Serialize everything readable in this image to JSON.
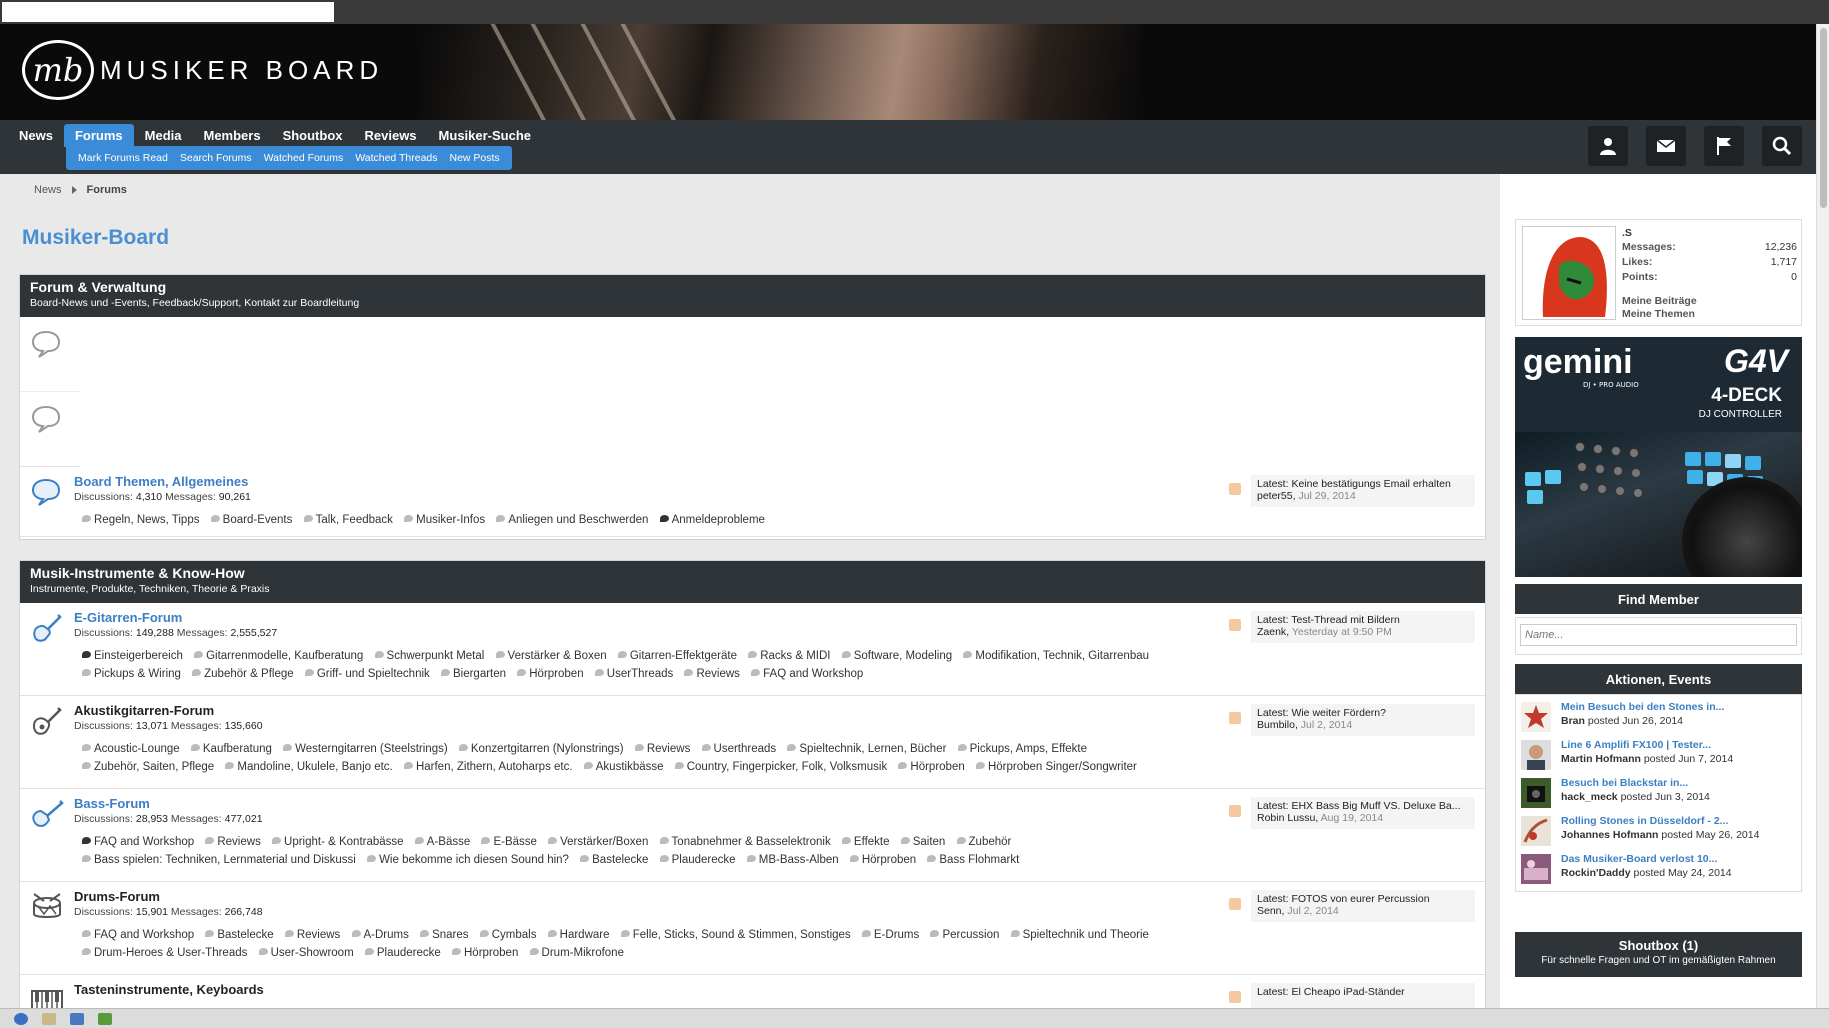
{
  "site": {
    "logo_mark": "mb",
    "logo_text": "MUSIKER BOARD"
  },
  "nav": {
    "tabs": [
      "News",
      "Forums",
      "Media",
      "Members",
      "Shoutbox",
      "Reviews",
      "Musiker-Suche"
    ],
    "active_tab": "Forums",
    "subnav": [
      "Mark Forums Read",
      "Search Forums",
      "Watched Forums",
      "Watched Threads",
      "New Posts"
    ],
    "icons": [
      "user-icon",
      "mail-icon",
      "flag-icon",
      "search-icon"
    ]
  },
  "breadcrumb": {
    "items": [
      "News",
      "Forums"
    ]
  },
  "page_title": "Musiker-Board",
  "categories": [
    {
      "title": "Forum & Verwaltung",
      "desc": "Board-News und -Events, Feedback/Support, Kontakt zur Boardleitung",
      "nodes": [
        {
          "title": "Board Themen, Allgemeines",
          "discussions": "4,310",
          "messages": "90,261",
          "subforums": [
            "Regeln, News, Tipps",
            "Board-Events",
            "Talk, Feedback",
            "Musiker-Infos",
            "Anliegen und Beschwerden",
            "Anmeldeprobleme"
          ],
          "latest": {
            "title": "Latest: Keine bestätigungs Email erhalten",
            "user": "peter55",
            "date": "Jul 29, 2014"
          }
        }
      ]
    },
    {
      "title": "Musik-Instrumente & Know-How",
      "desc": "Instrumente, Produkte, Techniken, Theorie & Praxis",
      "nodes": [
        {
          "title": "E-Gitarren-Forum",
          "discussions": "149,288",
          "messages": "2,555,527",
          "subforums": [
            "Einsteigerbereich",
            "Gitarrenmodelle, Kaufberatung",
            "Schwerpunkt Metal",
            "Verstärker & Boxen",
            "Gitarren-Effektgeräte",
            "Racks & MIDI",
            "Software, Modeling",
            "Modifikation, Technik, Gitarrenbau",
            "Pickups & Wiring",
            "Zubehör & Pflege",
            "Griff- und Spieltechnik",
            "Biergarten",
            "Hörproben",
            "UserThreads",
            "Reviews",
            "FAQ and Workshop"
          ],
          "latest": {
            "title": "Latest: Test-Thread mit Bildern",
            "user": "Zaenk",
            "date": "Yesterday at 9:50 PM"
          }
        },
        {
          "title": "Akustikgitarren-Forum",
          "discussions": "13,071",
          "messages": "135,660",
          "subforums": [
            "Acoustic-Lounge",
            "Kaufberatung",
            "Westerngitarren (Steelstrings)",
            "Konzertgitarren (Nylonstrings)",
            "Reviews",
            "Userthreads",
            "Spieltechnik, Lernen, Bücher",
            "Pickups, Amps, Effekte",
            "Zubehör, Saiten, Pflege",
            "Mandoline, Ukulele, Banjo etc.",
            "Harfen, Zithern, Autoharps etc.",
            "Akustikbässe",
            "Country, Fingerpicker, Folk, Volksmusik",
            "Hörproben",
            "Hörproben Singer/Songwriter"
          ],
          "latest": {
            "title": "Latest: Wie weiter Fördern?",
            "user": "Bumbilo",
            "date": "Jul 2, 2014"
          }
        },
        {
          "title": "Bass-Forum",
          "discussions": "28,953",
          "messages": "477,021",
          "subforums": [
            "FAQ and Workshop",
            "Reviews",
            "Upright- & Kontrabässe",
            "A-Bässe",
            "E-Bässe",
            "Verstärker/Boxen",
            "Tonabnehmer & Basselektronik",
            "Effekte",
            "Saiten",
            "Zubehör",
            "Bass spielen: Techniken, Lernmaterial und Diskussi",
            "Wie bekomme ich diesen Sound hin?",
            "Bastelecke",
            "Plauderecke",
            "MB-Bass-Alben",
            "Hörproben",
            "Bass Flohmarkt"
          ],
          "latest": {
            "title": "Latest: EHX Bass Big Muff VS. Deluxe Ba...",
            "user": "Robin Lussu",
            "date": "Aug 19, 2014"
          }
        },
        {
          "title": "Drums-Forum",
          "discussions": "15,901",
          "messages": "266,748",
          "subforums": [
            "FAQ and Workshop",
            "Bastelecke",
            "Reviews",
            "A-Drums",
            "Snares",
            "Cymbals",
            "Hardware",
            "Felle, Sticks, Sound & Stimmen, Sonstiges",
            "E-Drums",
            "Percussion",
            "Spieltechnik und Theorie",
            "Drum-Heroes & User-Threads",
            "User-Showroom",
            "Plauderecke",
            "Hörproben",
            "Drum-Mikrofone"
          ],
          "latest": {
            "title": "Latest: FOTOS von eurer Percussion",
            "user": "Senn",
            "date": "Jul 2, 2014"
          }
        },
        {
          "title": "Tasteninstrumente, Keyboards",
          "latest": {
            "title": "Latest: El Cheapo iPad-Ständer"
          }
        }
      ]
    }
  ],
  "stats_labels": {
    "discussions": "Discussions:",
    "messages": "Messages:"
  },
  "sidebar": {
    "visitor": {
      "name": ".S",
      "messages_label": "Messages:",
      "messages": "12,236",
      "likes_label": "Likes:",
      "likes": "1,717",
      "points_label": "Points:",
      "points": "0",
      "link1": "Meine Beiträge",
      "link2": "Meine Themen"
    },
    "ad": {
      "brand": "gemini",
      "brand_sub": "DJ • PRO AUDIO",
      "model": "G4V",
      "deck": "4-DECK",
      "controller": "DJ CONTROLLER"
    },
    "find_member": {
      "title": "Find Member",
      "placeholder": "Name..."
    },
    "events": {
      "title": "Aktionen, Events",
      "items": [
        {
          "title": "Mein Besuch bei den Stones in...",
          "user": "Bran",
          "posted": "posted Jun 26, 2014"
        },
        {
          "title": "Line 6 Amplifi FX100 | Tester...",
          "user": "Martin Hofmann",
          "posted": "posted Jun 7, 2014"
        },
        {
          "title": "Besuch bei Blackstar in...",
          "user": "hack_meck",
          "posted": "posted Jun 3, 2014"
        },
        {
          "title": "Rolling Stones in Düsseldorf - 2...",
          "user": "Johannes Hofmann",
          "posted": "posted May 26, 2014"
        },
        {
          "title": "Das Musiker-Board verlost 10...",
          "user": "Rockin'Daddy",
          "posted": "posted May 24, 2014"
        }
      ]
    },
    "shoutbox": {
      "title": "Shoutbox (1)",
      "desc": "Für schnelle Fragen und OT im gemäßigten Rahmen"
    }
  },
  "colors": {
    "accent": "#3b8cd8",
    "nav_bg": "#2f3438",
    "link": "#3b7fc4"
  }
}
